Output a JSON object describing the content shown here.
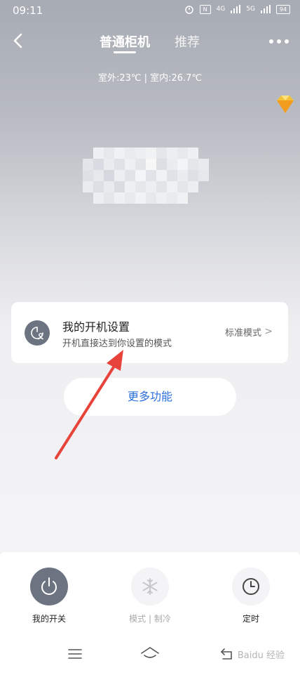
{
  "status_bar": {
    "time": "09:11",
    "signal_1": "4G",
    "signal_2": "5G",
    "battery": "94"
  },
  "header": {
    "tab_active": "普通柜机",
    "tab_other": "推荐"
  },
  "temperature": "室外:23℃ | 室内:26.7℃",
  "card": {
    "title": "我的开机设置",
    "subtitle": "开机直接达到你设置的模式",
    "value": "标准模式",
    "chevron": ">"
  },
  "more_button": "更多功能",
  "controls": [
    {
      "label": "我的开关",
      "icon": "power-icon"
    },
    {
      "label": "模式 | 制冷",
      "icon": "snowflake-icon"
    },
    {
      "label": "定时",
      "icon": "clock-icon"
    }
  ],
  "nav_icons": [
    "menu-icon",
    "home-icon",
    "back-nav-icon"
  ],
  "watermark": "Baidu 经验",
  "colors": {
    "accent_blue": "#2a6fdb",
    "power_bg": "#6d7481",
    "arrow_red": "#e8433b"
  }
}
